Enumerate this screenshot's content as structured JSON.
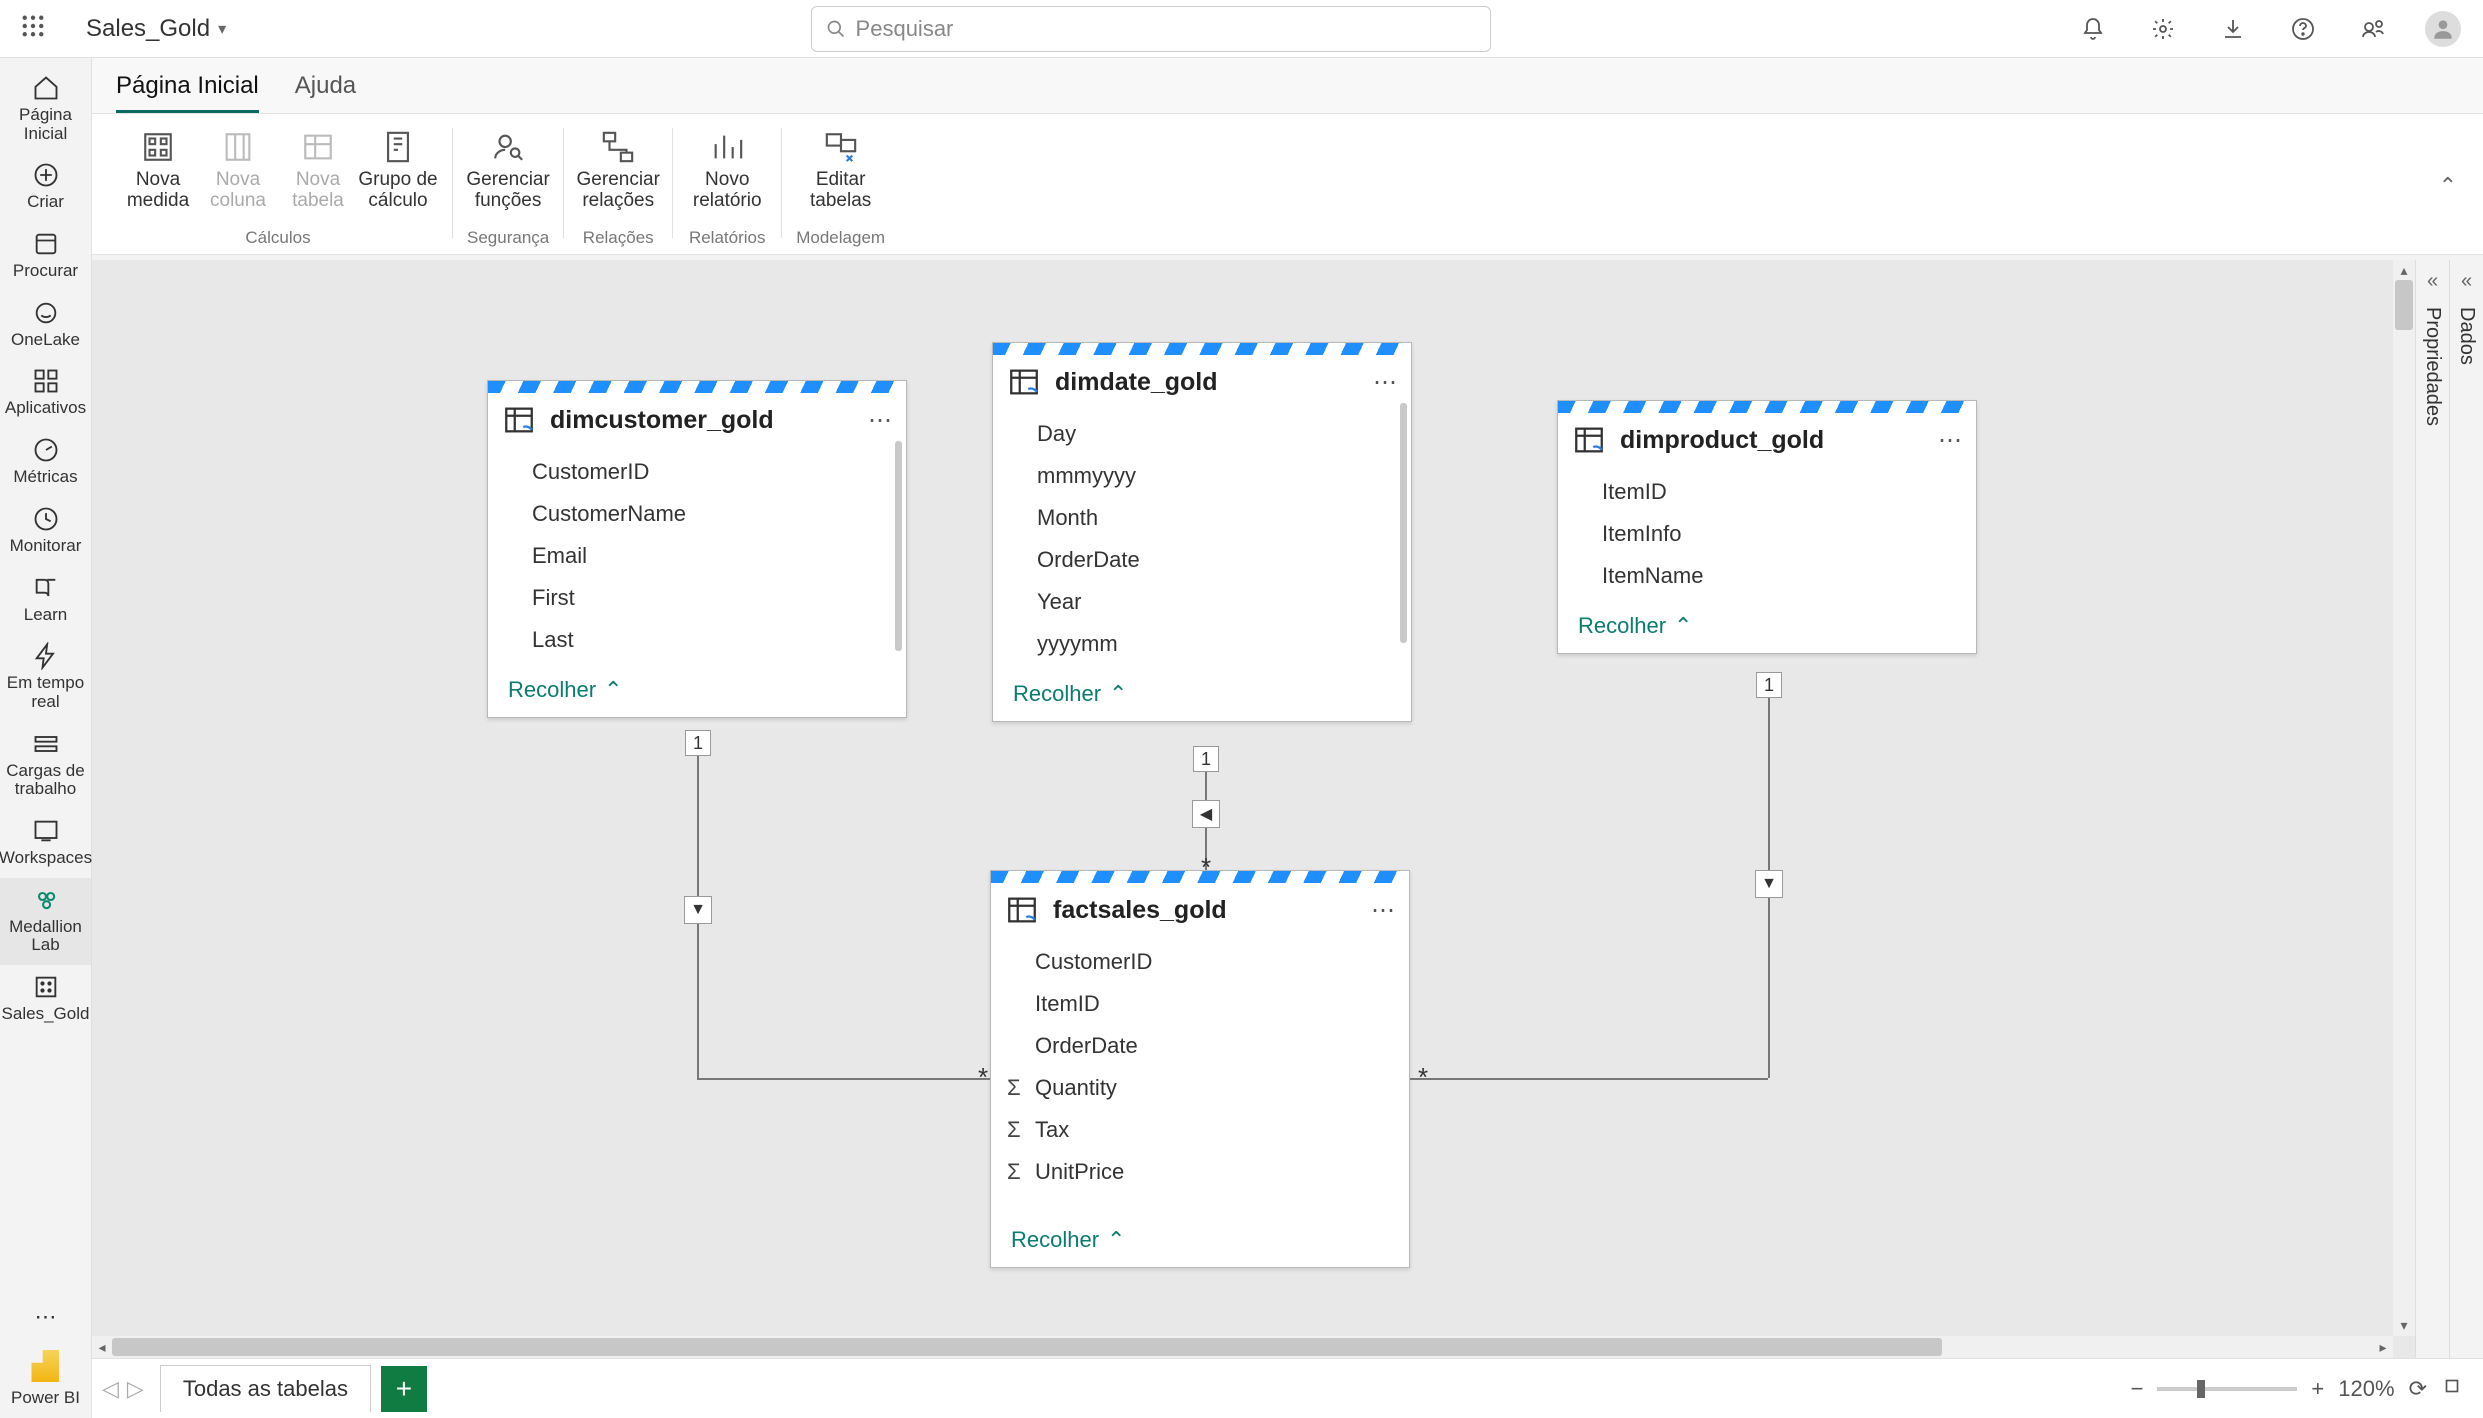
{
  "top": {
    "modelName": "Sales_Gold",
    "searchPlaceholder": "Pesquisar"
  },
  "leftRail": [
    {
      "label": "Página Inicial"
    },
    {
      "label": "Criar"
    },
    {
      "label": "Procurar"
    },
    {
      "label": "OneLake"
    },
    {
      "label": "Aplicativos"
    },
    {
      "label": "Métricas"
    },
    {
      "label": "Monitorar"
    },
    {
      "label": "Learn"
    },
    {
      "label": "Em tempo real"
    },
    {
      "label": "Cargas de trabalho"
    },
    {
      "label": "Workspaces"
    },
    {
      "label": "Medallion Lab"
    },
    {
      "label": "Sales_Gold"
    }
  ],
  "leftRailFooter": "Power BI",
  "ribbonTabs": {
    "home": "Página Inicial",
    "help": "Ajuda"
  },
  "ribbon": {
    "calcGroup": {
      "novaMedida1": "Nova",
      "novaMedida2": "medida",
      "novaColuna1": "Nova",
      "novaColuna2": "coluna",
      "novaTabela1": "Nova",
      "novaTabela2": "tabela",
      "grupoCalc1": "Grupo de",
      "grupoCalc2": "cálculo",
      "caption": "Cálculos"
    },
    "secGroup": {
      "gerFunc1": "Gerenciar",
      "gerFunc2": "funções",
      "caption": "Segurança"
    },
    "relGroup": {
      "gerRel1": "Gerenciar",
      "gerRel2": "relações",
      "caption": "Relações"
    },
    "repGroup": {
      "novoRep1": "Novo",
      "novoRep2": "relatório",
      "caption": "Relatórios"
    },
    "modGroup": {
      "editTab1": "Editar",
      "editTab2": "tabelas",
      "caption": "Modelagem"
    }
  },
  "tables": {
    "dimcustomer": {
      "name": "dimcustomer_gold",
      "cols": [
        "CustomerID",
        "CustomerName",
        "Email",
        "First",
        "Last"
      ],
      "collapse": "Recolher"
    },
    "dimdate": {
      "name": "dimdate_gold",
      "cols": [
        "Day",
        "mmmyyyy",
        "Month",
        "OrderDate",
        "Year",
        "yyyymm"
      ],
      "collapse": "Recolher"
    },
    "dimproduct": {
      "name": "dimproduct_gold",
      "cols": [
        "ItemID",
        "ItemInfo",
        "ItemName"
      ],
      "collapse": "Recolher"
    },
    "factsales": {
      "name": "factsales_gold",
      "cols": [
        {
          "n": "CustomerID",
          "agg": false
        },
        {
          "n": "ItemID",
          "agg": false
        },
        {
          "n": "OrderDate",
          "agg": false
        },
        {
          "n": "Quantity",
          "agg": true
        },
        {
          "n": "Tax",
          "agg": true
        },
        {
          "n": "UnitPrice",
          "agg": true
        }
      ],
      "collapse": "Recolher"
    }
  },
  "cardinality": {
    "one": "1",
    "many": "*"
  },
  "rightPanes": {
    "props": "Propriedades",
    "data": "Dados"
  },
  "bottom": {
    "sheet": "Todas as tabelas",
    "zoom": "120%"
  }
}
